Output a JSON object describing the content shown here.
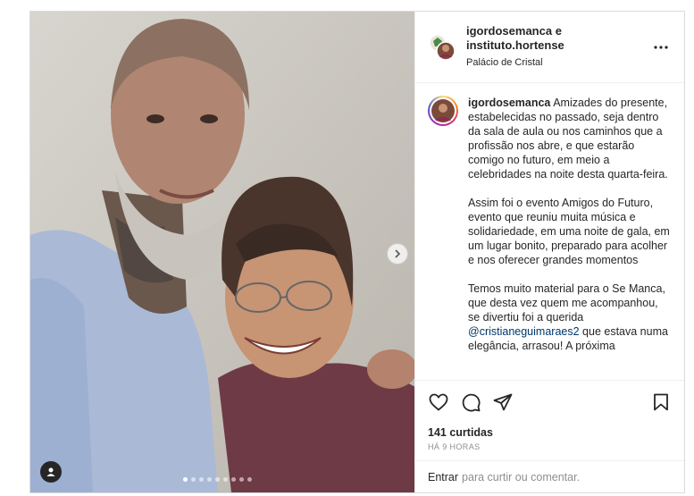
{
  "post": {
    "owner": "igordosemanca e instituto.hortense",
    "location": "Palácio de Cristal"
  },
  "caption": {
    "username": "igordosemanca",
    "paragraph1": "Amizades do presente, estabelecidas no passado, seja dentro da sala de aula ou nos caminhos que a profissão nos abre, e que estarão comigo no futuro, em meio a celebridades na noite desta quarta-feira.",
    "paragraph2": "Assim foi o evento Amigos do Futuro, evento que reuniu muita música e solidariedade, em uma noite de gala, em um lugar bonito, preparado para acolher e nos oferecer grandes momentos",
    "paragraph3_start": "Temos muito material para o Se Manca, que desta vez quem me acompanhou, se divertiu foi a querida",
    "mention": "@cristianeguimaraes2",
    "paragraph3_end": "que estava numa elegância, arrasou! A próxima"
  },
  "stats": {
    "shares": "141 curtidas",
    "time": "HÁ 9 HORAS"
  },
  "comment": {
    "prefix": "Entrar",
    "placeholder": "para curtir ou comentar."
  },
  "carousel": {
    "slides": 9,
    "active": 0
  },
  "icons": {
    "more": "more-icon",
    "like": "heart-icon",
    "comment": "comment-icon",
    "share": "share-icon",
    "save": "bookmark-icon",
    "next": "chevron-right-icon",
    "tag": "user-tag-icon"
  }
}
